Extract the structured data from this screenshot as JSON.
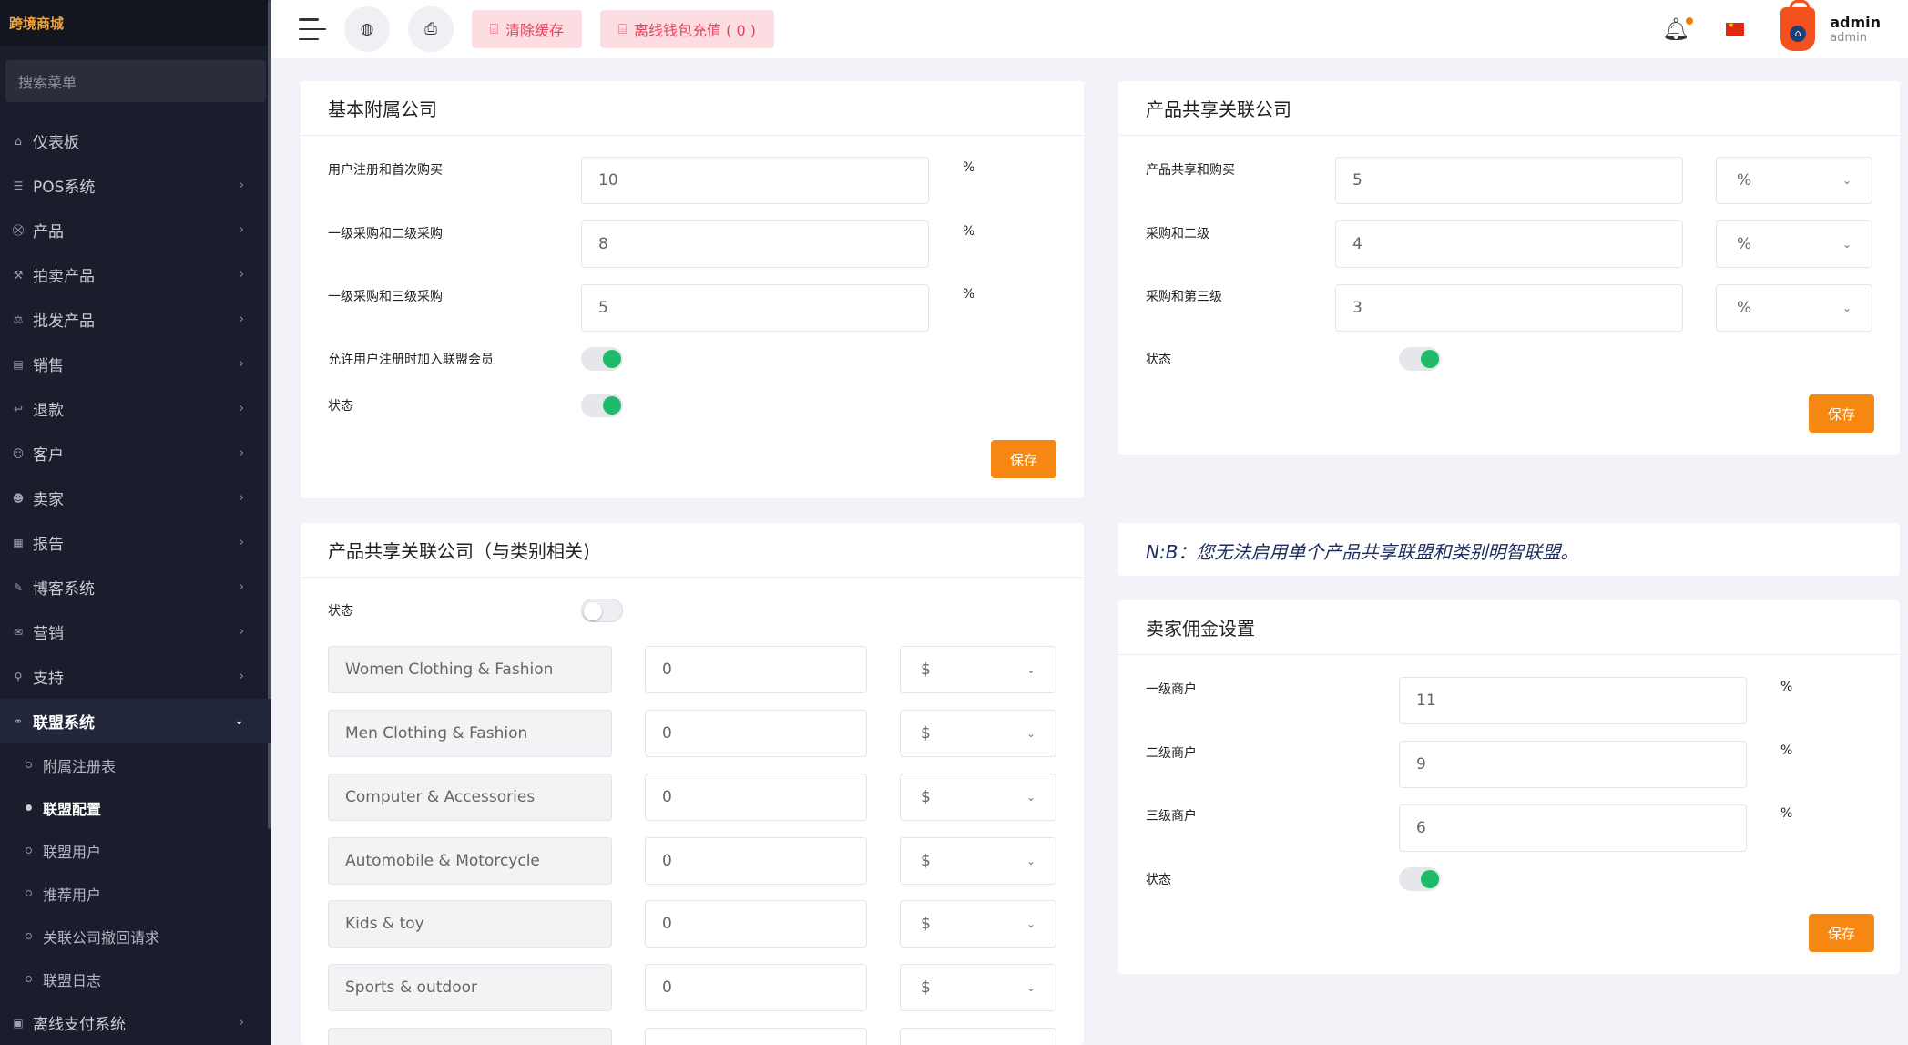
{
  "sidebar": {
    "brand": "跨境商城",
    "search_placeholder": "搜索菜单",
    "menu": [
      {
        "label": "仪表板",
        "icon": "⌂",
        "chevron": ""
      },
      {
        "label": "POS系统",
        "icon": "☰",
        "chevron": "›"
      },
      {
        "label": "产品",
        "icon": "⛒",
        "chevron": "›"
      },
      {
        "label": "拍卖产品",
        "icon": "⚒",
        "chevron": "›"
      },
      {
        "label": "批发产品",
        "icon": "⚖",
        "chevron": "›"
      },
      {
        "label": "销售",
        "icon": "▤",
        "chevron": "›"
      },
      {
        "label": "退款",
        "icon": "↩",
        "chevron": "›"
      },
      {
        "label": "客户",
        "icon": "☺",
        "chevron": "›"
      },
      {
        "label": "卖家",
        "icon": "☻",
        "chevron": "›"
      },
      {
        "label": "报告",
        "icon": "▦",
        "chevron": "›"
      },
      {
        "label": "博客系统",
        "icon": "✎",
        "chevron": "›"
      },
      {
        "label": "营销",
        "icon": "✉",
        "chevron": "›"
      },
      {
        "label": "支持",
        "icon": "⚲",
        "chevron": "›"
      },
      {
        "label": "联盟系统",
        "icon": "⚭",
        "chevron": "⌄"
      }
    ],
    "submenu": [
      "附属注册表",
      "联盟配置",
      "联盟用户",
      "推荐用户",
      "关联公司撤回请求",
      "联盟日志"
    ],
    "last_item": {
      "label": "离线支付系统",
      "icon": "▣",
      "chevron": "›"
    }
  },
  "topbar": {
    "clear_cache": "清除缓存",
    "offline_wallet": "离线钱包充值 ( 0 )",
    "user_name": "admin",
    "user_role": "admin"
  },
  "basic_affiliate": {
    "title": "基本附属公司",
    "rows": [
      {
        "label": "用户注册和首次购买",
        "value": "10",
        "unit": "%"
      },
      {
        "label": "一级采购和二级采购",
        "value": "8",
        "unit": "%"
      },
      {
        "label": "一级采购和三级采购",
        "value": "5",
        "unit": "%"
      }
    ],
    "allow_join_label": "允许用户注册时加入联盟会员",
    "status_label": "状态",
    "save": "保存"
  },
  "product_share": {
    "title": "产品共享关联公司",
    "rows": [
      {
        "label": "产品共享和购买",
        "value": "5",
        "unit": "%"
      },
      {
        "label": "采购和二级",
        "value": "4",
        "unit": "%"
      },
      {
        "label": "采购和第三级",
        "value": "3",
        "unit": "%"
      }
    ],
    "status_label": "状态",
    "save": "保存"
  },
  "category_share": {
    "title": "产品共享关联公司（与类别相关)",
    "status_label": "状态",
    "categories": [
      {
        "name": "Women Clothing & Fashion",
        "value": "0",
        "currency": "$"
      },
      {
        "name": "Men Clothing & Fashion",
        "value": "0",
        "currency": "$"
      },
      {
        "name": "Computer & Accessories",
        "value": "0",
        "currency": "$"
      },
      {
        "name": "Automobile & Motorcycle",
        "value": "0",
        "currency": "$"
      },
      {
        "name": "Kids & toy",
        "value": "0",
        "currency": "$"
      },
      {
        "name": "Sports & outdoor",
        "value": "0",
        "currency": "$"
      }
    ]
  },
  "note": "N:B：您无法启用单个产品共享联盟和类别明智联盟。",
  "seller_commission": {
    "title": "卖家佣金设置",
    "rows": [
      {
        "label": "一级商户",
        "value": "11",
        "unit": "%"
      },
      {
        "label": "二级商户",
        "value": "9",
        "unit": "%"
      },
      {
        "label": "三级商户",
        "value": "6",
        "unit": "%"
      }
    ],
    "status_label": "状态",
    "save": "保存"
  },
  "colors": {
    "accent": "#f68712",
    "toggle_on": "#1ebc6a",
    "sidebar_bg": "#1a1d2b",
    "pink_button": "#fbdde2"
  }
}
